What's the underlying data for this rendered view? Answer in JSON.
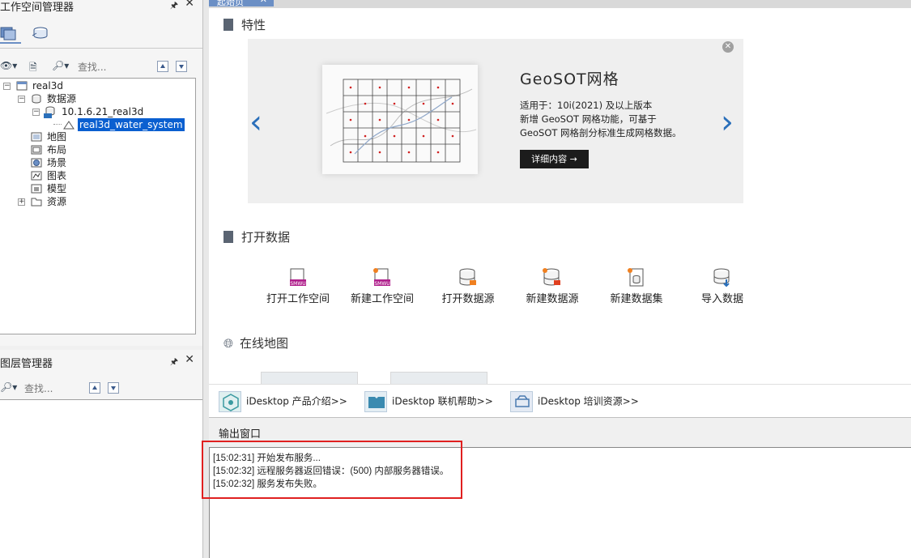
{
  "workspace_panel": {
    "title": "工作空间管理器",
    "search_placeholder": "查找...",
    "tree": [
      {
        "label": "real3d"
      },
      {
        "label": "数据源"
      },
      {
        "label": "10.1.6.21_real3d"
      },
      {
        "label": "real3d_water_system"
      },
      {
        "label": "地图"
      },
      {
        "label": "布局"
      },
      {
        "label": "场景"
      },
      {
        "label": "图表"
      },
      {
        "label": "模型"
      },
      {
        "label": "资源"
      }
    ]
  },
  "layer_panel": {
    "title": "图层管理器",
    "search_placeholder": "查找..."
  },
  "start_page": {
    "tab_label": "起始页",
    "features_heading": "特性",
    "banner": {
      "title": "GeoSOT网格",
      "line1": "适用于：10i(2021) 及以上版本",
      "line2": "新增 GeoSOT 网格功能，可基于",
      "line3": "GeoSOT 网格剖分标准生成网格数据。",
      "button": "详细内容 →"
    },
    "open_data_heading": "打开数据",
    "quick_actions": [
      {
        "label": "打开工作空间",
        "icon": "open-workspace-icon"
      },
      {
        "label": "新建工作空间",
        "icon": "new-workspace-icon"
      },
      {
        "label": "打开数据源",
        "icon": "open-datasource-icon"
      },
      {
        "label": "新建数据源",
        "icon": "new-datasource-icon"
      },
      {
        "label": "新建数据集",
        "icon": "new-dataset-icon"
      },
      {
        "label": "导入数据",
        "icon": "import-data-icon"
      }
    ],
    "online_map_heading": "在线地图",
    "links": [
      {
        "label": "iDesktop 产品介绍>>"
      },
      {
        "label": "iDesktop 联机帮助>>"
      },
      {
        "label": "iDesktop 培训资源>>"
      }
    ]
  },
  "output": {
    "title": "输出窗口",
    "lines": [
      "[15:02:31] 开始发布服务...",
      "[15:02:32] 远程服务器返回错误：(500) 内部服务器错误。",
      "[15:02:32] 服务发布失败。"
    ]
  },
  "colors": {
    "accent": "#6b8fc5",
    "selection": "#0a5fd0",
    "arrow_blue": "#2a6fba",
    "highlight_box": "#e02020"
  }
}
